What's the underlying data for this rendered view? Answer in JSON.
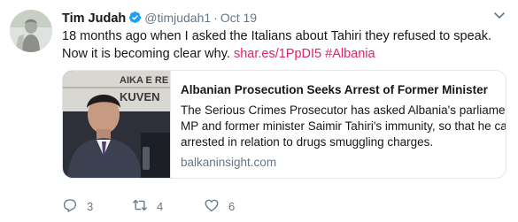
{
  "tweet": {
    "author_name": "Tim Judah",
    "handle": "@timjudah1",
    "separator": "·",
    "time": "Oct 19",
    "text_line1": "18 months ago when I asked the Italians about Tahiri they refused to speak.",
    "text_line2_prefix": "Now it is becoming clear why.",
    "link": "shar.es/1PpDI5",
    "hashtag": "#Albania"
  },
  "card": {
    "image_caption_partial_1": "AIKA E RE",
    "image_caption_partial_2": "KUVEN",
    "title": "Albanian Prosecution Seeks Arrest of Former Minister",
    "description_lines": [
      "The Serious Crimes Prosecutor has asked Albania's parliament to lift",
      "MP and former minister Saimir Tahiri's immunity, so that he can be",
      "arrested in relation to drugs smuggling charges."
    ],
    "domain": "balkaninsight.com"
  },
  "actions": {
    "replies": "3",
    "retweets": "4",
    "likes": "6"
  },
  "colors": {
    "link": "#e0245e",
    "verified": "#1da1f2",
    "muted": "#657786",
    "border": "#e1e8ed"
  },
  "icons": [
    "verified-badge-icon",
    "chevron-down-icon",
    "reply-icon",
    "retweet-icon",
    "like-icon"
  ]
}
